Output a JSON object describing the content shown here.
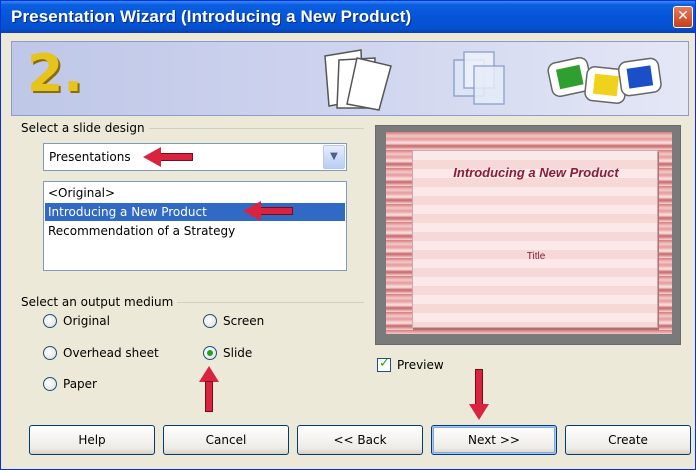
{
  "window": {
    "title": "Presentation Wizard (Introducing a New Product)",
    "close_symbol": "✕"
  },
  "banner": {
    "step_number": "2."
  },
  "slide_design": {
    "group_label": "Select a slide design",
    "category_value": "Presentations",
    "templates": [
      {
        "label": "<Original>",
        "selected": false
      },
      {
        "label": "Introducing a New Product",
        "selected": true
      },
      {
        "label": "Recommendation of a Strategy",
        "selected": false
      }
    ]
  },
  "output_medium": {
    "group_label": "Select an output medium",
    "options": {
      "original": {
        "label": "Original",
        "checked": false
      },
      "screen": {
        "label": "Screen",
        "checked": false
      },
      "overhead": {
        "label": "Overhead sheet",
        "checked": false
      },
      "slide": {
        "label": "Slide",
        "checked": true
      },
      "paper": {
        "label": "Paper",
        "checked": false
      }
    }
  },
  "preview": {
    "slide_title": "Introducing a New Product",
    "slide_subtitle": "Title",
    "checkbox_label": "Preview",
    "checked": true
  },
  "buttons": {
    "help": "Help",
    "cancel": "Cancel",
    "back": "<< Back",
    "next": "Next >>",
    "create": "Create"
  },
  "colors": {
    "title_bar": "#0655d8",
    "selection": "#316ac5",
    "annotation_arrow": "#d8243f",
    "step_number": "#e7c31d",
    "slide_text": "#8a1c36"
  },
  "icons": [
    "pages-icon",
    "layers-icon",
    "color-slides-icon",
    "dropdown-arrow-icon",
    "close-icon"
  ]
}
